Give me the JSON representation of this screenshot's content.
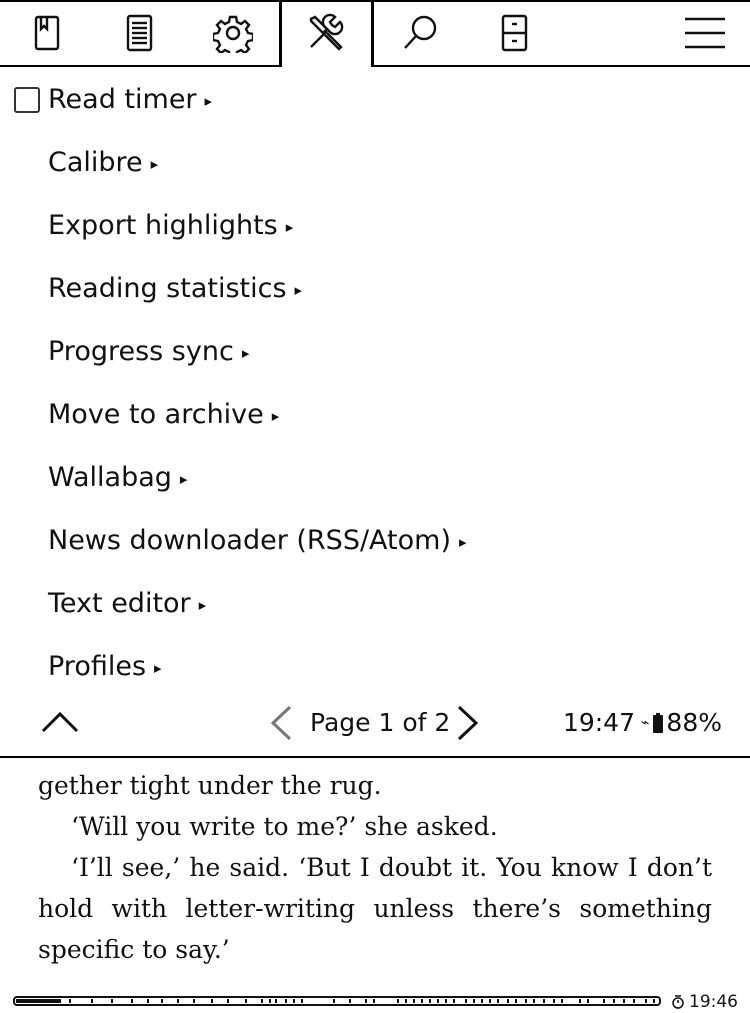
{
  "tabs": [
    {
      "name": "bookmark-icon"
    },
    {
      "name": "document-icon"
    },
    {
      "name": "gear-icon"
    },
    {
      "name": "tools-icon"
    },
    {
      "name": "search-icon"
    },
    {
      "name": "cabinet-icon"
    },
    {
      "name": "hamburger-menu-icon"
    }
  ],
  "menu": {
    "items": [
      {
        "label": "Read timer",
        "checkbox": true
      },
      {
        "label": "Calibre"
      },
      {
        "label": "Export highlights"
      },
      {
        "label": "Reading statistics"
      },
      {
        "label": "Progress sync"
      },
      {
        "label": "Move to archive"
      },
      {
        "label": "Wallabag"
      },
      {
        "label": "News downloader (RSS/Atom)"
      },
      {
        "label": "Text editor"
      },
      {
        "label": "Profiles"
      }
    ],
    "submenu_arrow": "▸"
  },
  "footer": {
    "page_label": "Page 1 of 2",
    "time": "19:47",
    "battery": "88%"
  },
  "book": {
    "paragraphs": [
      "gether tight under the rug.",
      "‘Will you write to me?’ she asked.",
      "‘I’ll see,’ he said. ‘But I doubt it. You know I don’t hold with letter-writing unless there’s something specific to say.’"
    ]
  },
  "statusbar": {
    "clock": "19:46",
    "progress": 0.07
  }
}
